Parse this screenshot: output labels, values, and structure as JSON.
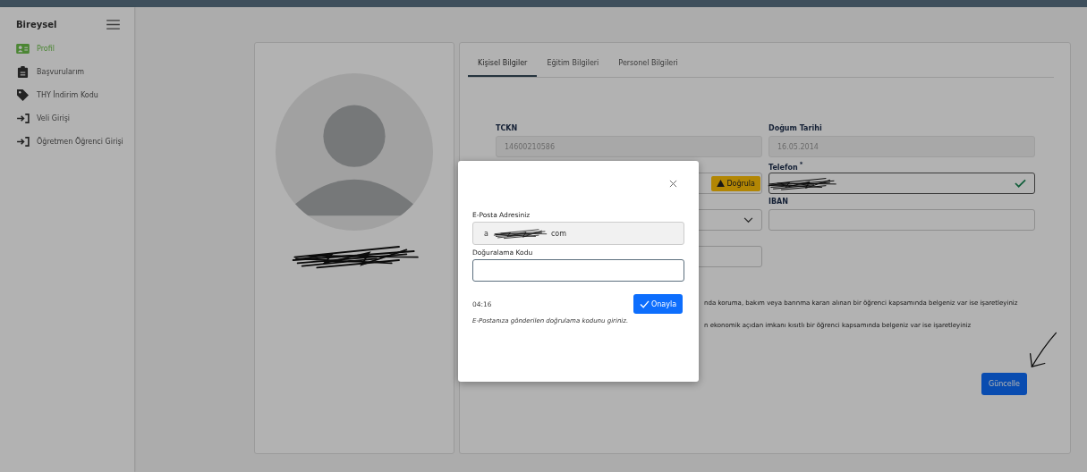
{
  "sidebar": {
    "title": "Bireysel",
    "items": [
      {
        "label": "Profil",
        "kind": "profile",
        "selected": true
      },
      {
        "label": "Başvurularım",
        "kind": "applications",
        "selected": false
      },
      {
        "label": "THY İndirim Kodu",
        "kind": "discount",
        "selected": false
      },
      {
        "label": "Veli Girişi",
        "kind": "login",
        "selected": false
      },
      {
        "label": "Öğretmen Öğrenci Girişi",
        "kind": "login",
        "selected": false
      }
    ]
  },
  "profile_card": {
    "name_redacted": true
  },
  "tabs": [
    {
      "label": "Kişisel Bilgiler",
      "selected": true
    },
    {
      "label": "Eğitim Bilgileri",
      "selected": false
    },
    {
      "label": "Personel Bilgileri",
      "selected": false
    }
  ],
  "form": {
    "fields": [
      {
        "kind": "text",
        "label": "TCKN",
        "value": "14600210586",
        "disabled": true
      },
      {
        "kind": "text",
        "label": "Doğum Tarihi",
        "value": "16.05.2014",
        "disabled": true
      },
      {
        "kind": "verify",
        "button": "Doğrula",
        "disabled": false
      },
      {
        "kind": "text",
        "label": "Telefon",
        "required_mark": "*",
        "redacted": true,
        "valid": true,
        "disabled": false
      },
      {
        "kind": "select",
        "disabled": false
      },
      {
        "kind": "text",
        "label": "IBAN",
        "disabled": false
      },
      {
        "kind": "text",
        "disabled": false
      }
    ],
    "notes": [
      "nda koruma, bakım veya barınma kararı alınan bir öğrenci kapsamında belgeniz var ise işaretleyiniz",
      "n ekonomik açıdan imkanı kısıtlı bir öğrenci kapsamında belgeniz var ise işaretleyiniz"
    ],
    "update_button": "Güncelle",
    "annotation_arrow": true
  },
  "modal": {
    "email_label": "E-Posta Adresiniz",
    "email_start": "a",
    "email_end": "com",
    "email_redacted": true,
    "code_label": "Doğuralama Kodu",
    "timer": "04:16",
    "confirm_button": "Onayla",
    "hint": "E-Postanıza gönderilen doğrulama kodunu giriniz."
  }
}
